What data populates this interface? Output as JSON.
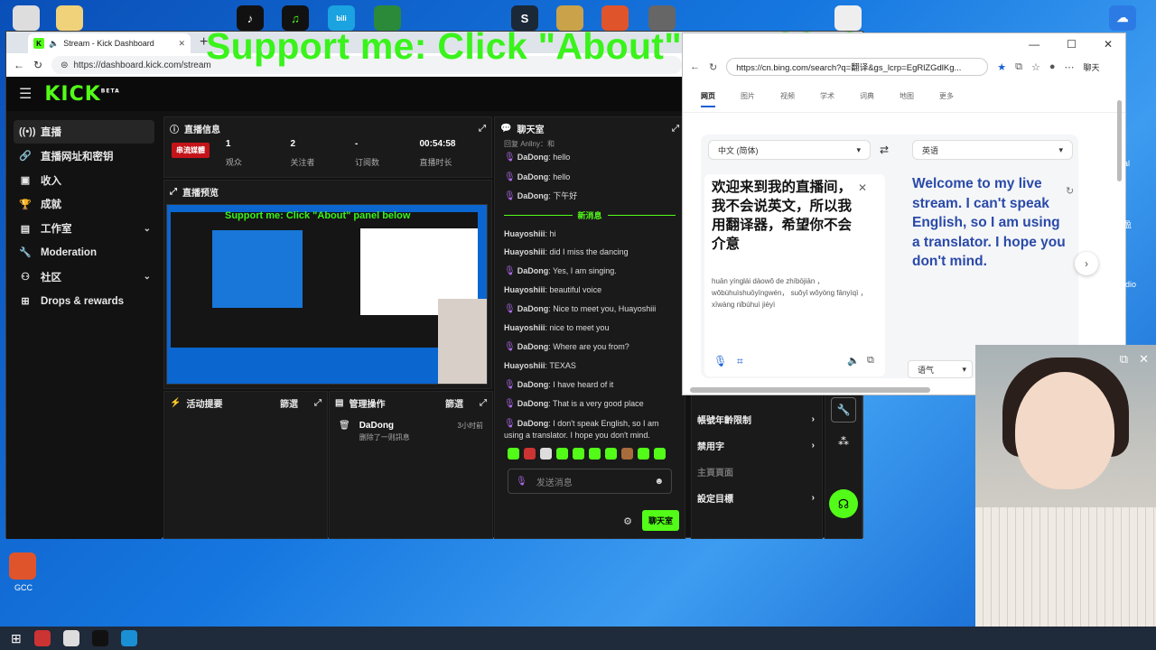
{
  "overlay": {
    "text": "Support me: Click \"About\" panel below"
  },
  "browser": {
    "tab_title": "Stream - Kick Dashboard",
    "url": "https://dashboard.kick.com/stream"
  },
  "kick": {
    "logo": "KICK",
    "logo_sup": "BETA",
    "sidebar": [
      {
        "label": "直播",
        "icon": "broadcast-icon"
      },
      {
        "label": "直播网址和密钥",
        "icon": "link-icon"
      },
      {
        "label": "收入",
        "icon": "wallet-icon"
      },
      {
        "label": "成就",
        "icon": "trophy-icon"
      },
      {
        "label": "工作室",
        "icon": "studio-icon"
      },
      {
        "label": "Moderation",
        "icon": "wrench-icon"
      },
      {
        "label": "社区",
        "icon": "community-icon"
      },
      {
        "label": "Drops & rewards",
        "icon": "gift-icon"
      }
    ],
    "stream_info": {
      "title": "直播信息",
      "live_badge": "串流媒體",
      "stats": [
        {
          "value": "1",
          "label": "观众"
        },
        {
          "value": "2",
          "label": "关注者"
        },
        {
          "value": "-",
          "label": "订阅数"
        },
        {
          "value": "00:54:58",
          "label": "直播时长"
        }
      ]
    },
    "preview": {
      "title": "直播预览",
      "overlay_text": "Support me: Click \"About\" panel below"
    },
    "activity": {
      "title": "活动提要",
      "filter": "篩選"
    },
    "mod_actions": {
      "title": "管理操作",
      "filter": "篩選",
      "user": "DaDong",
      "time": "3小时前",
      "desc": "删除了一则訊息"
    },
    "chat": {
      "title": "聊天室",
      "reply_hint": "回复 Anllny：和",
      "new_messages": "新消息",
      "messages": [
        {
          "user": "DaDong",
          "text": "hello",
          "mic": true
        },
        {
          "user": "DaDong",
          "text": "hello",
          "mic": true
        },
        {
          "user": "DaDong",
          "text": "下午好",
          "mic": true
        }
      ],
      "messages_after": [
        {
          "user": "Huayoshiii",
          "text": "hi",
          "mic": false
        },
        {
          "user": "Huayoshiii",
          "text": "did I miss the dancing",
          "mic": false
        },
        {
          "user": "DaDong",
          "text": "Yes, I am singing.",
          "mic": true
        },
        {
          "user": "Huayoshiii",
          "text": "beautiful voice",
          "mic": false
        },
        {
          "user": "DaDong",
          "text": "Nice to meet you, Huayoshiii",
          "mic": true
        },
        {
          "user": "Huayoshiii",
          "text": "nice to meet you",
          "mic": false
        },
        {
          "user": "DaDong",
          "text": "Where are you from?",
          "mic": true
        },
        {
          "user": "Huayoshiii",
          "text": "TEXAS",
          "mic": false
        },
        {
          "user": "DaDong",
          "text": "I have heard of it",
          "mic": true
        },
        {
          "user": "DaDong",
          "text": "That is a very good place",
          "mic": true
        },
        {
          "user": "DaDong",
          "text": "I don't speak English, so I am using a translator. I hope you don't mind.",
          "mic": true
        }
      ],
      "input_placeholder": "发送消息",
      "send_label": "聊天室"
    },
    "mod_panel": [
      {
        "label": "帳號年齡限制",
        "chev": true
      },
      {
        "label": "禁用字",
        "chev": true
      },
      {
        "label": "主頁頁面",
        "chev": false
      },
      {
        "label": "設定目標",
        "chev": true
      }
    ]
  },
  "translator": {
    "url": "https://cn.bing.com/search?q=翻译&gs_lcrp=EgRlZGdlKg...",
    "user_label": "聊天",
    "nav": [
      "网页",
      "图片",
      "视频",
      "学术",
      "词典",
      "地图",
      "更多"
    ],
    "src_lang": "中文 (简体)",
    "tgt_lang": "英语",
    "source_text": "欢迎来到我的直播间，我不会说英文，所以我用翻译器，希望你不会介意",
    "pinyin": "huān yínglái dàowǒ de zhíbōjiān ， wǒbùhuìshuōyīngwén， suǒyǐ wǒyòng fānyìqì ， xīwàng nǐbúhuì jièyì",
    "target_text": "Welcome to my live stream. I can't speak English, so I am using a translator. I hope you don't mind.",
    "tone": "语气"
  },
  "desktop": {
    "gcc_label": "GCC",
    "tray_labels": [
      "al",
      "盈",
      "udio"
    ]
  }
}
